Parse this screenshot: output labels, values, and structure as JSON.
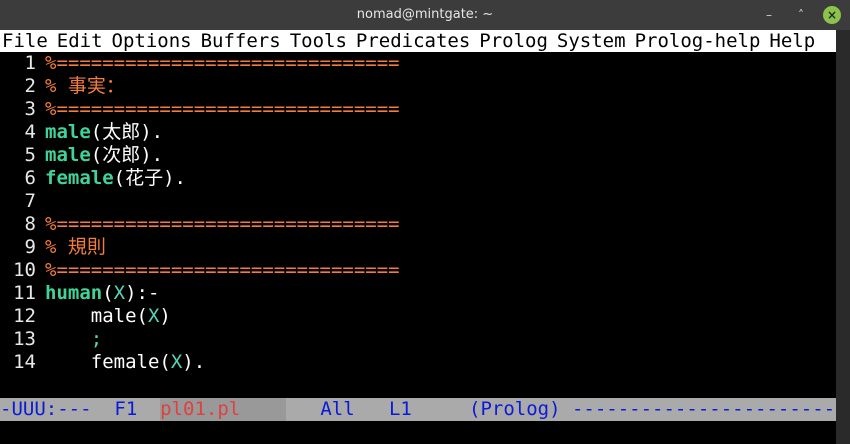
{
  "window": {
    "title": "nomad@mintgate: ~"
  },
  "menu": [
    "File",
    "Edit",
    "Options",
    "Buffers",
    "Tools",
    "Predicates",
    "Prolog",
    "System",
    "Prolog-help",
    "Help"
  ],
  "lines": [
    {
      "n": "1",
      "parts": [
        {
          "t": "%==============================",
          "c": "comment"
        }
      ]
    },
    {
      "n": "2",
      "parts": [
        {
          "t": "% 事実：",
          "c": "comment"
        }
      ]
    },
    {
      "n": "3",
      "parts": [
        {
          "t": "%==============================",
          "c": "comment"
        }
      ]
    },
    {
      "n": "4",
      "parts": [
        {
          "t": "male",
          "c": "kw"
        },
        {
          "t": "(太郎).",
          "c": "plain"
        }
      ]
    },
    {
      "n": "5",
      "parts": [
        {
          "t": "male",
          "c": "kw"
        },
        {
          "t": "(次郎).",
          "c": "plain"
        }
      ]
    },
    {
      "n": "6",
      "parts": [
        {
          "t": "female",
          "c": "kw"
        },
        {
          "t": "(花子).",
          "c": "plain"
        }
      ]
    },
    {
      "n": "7",
      "parts": []
    },
    {
      "n": "8",
      "parts": [
        {
          "t": "%==============================",
          "c": "comment"
        }
      ]
    },
    {
      "n": "9",
      "parts": [
        {
          "t": "% 規則",
          "c": "comment"
        }
      ]
    },
    {
      "n": "10",
      "parts": [
        {
          "t": "%==============================",
          "c": "comment"
        }
      ]
    },
    {
      "n": "11",
      "parts": [
        {
          "t": "human",
          "c": "kw"
        },
        {
          "t": "(",
          "c": "plain"
        },
        {
          "t": "X",
          "c": "var"
        },
        {
          "t": "):-",
          "c": "plain"
        }
      ]
    },
    {
      "n": "12",
      "parts": [
        {
          "t": "    male(",
          "c": "plain"
        },
        {
          "t": "X",
          "c": "var"
        },
        {
          "t": ")",
          "c": "plain"
        }
      ]
    },
    {
      "n": "13",
      "parts": [
        {
          "t": "    ;",
          "c": "var"
        }
      ]
    },
    {
      "n": "14",
      "parts": [
        {
          "t": "    female(",
          "c": "plain"
        },
        {
          "t": "X",
          "c": "var"
        },
        {
          "t": ").",
          "c": "plain"
        }
      ]
    }
  ],
  "modeline": {
    "status": "-UUU:---  F1  ",
    "buffer": "pl01.pl",
    "position": "   All   L1     ",
    "mode": "(Prolog)",
    "tail": " ------------------------"
  }
}
